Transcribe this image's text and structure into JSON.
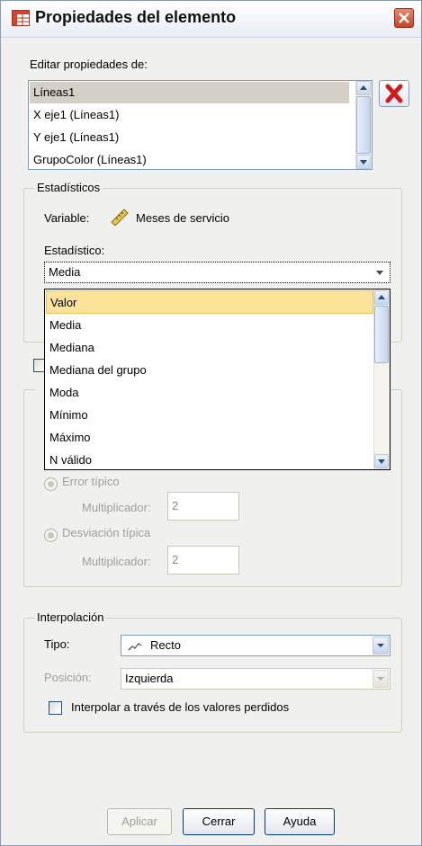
{
  "window": {
    "title": "Propiedades del elemento",
    "title_icon": "table-grid-icon",
    "close_icon": "close-x-icon"
  },
  "edit_props": {
    "label": "Editar propiedades de:",
    "items": [
      "Líneas1",
      "X eje1 (Líneas1)",
      "Y eje1 (Líneas1)",
      "GrupoColor (Líneas1)"
    ],
    "selected_index": 0,
    "delete_icon": "red-x-delete-icon"
  },
  "statistics": {
    "title": "Estadísticos",
    "variable_label": "Variable:",
    "variable_icon": "ruler-scale-icon",
    "variable_value": "Meses de servicio",
    "stat_label": "Estadístico:",
    "stat_value": "Media",
    "options": [
      "Valor",
      "Media",
      "Mediana",
      "Mediana del grupo",
      "Moda",
      "Mínimo",
      "Máximo",
      "N válido"
    ],
    "highlighted_option": "Valor"
  },
  "error_bars": {
    "std_error_label": "Error típico",
    "multiplier_label": "Multiplicador:",
    "std_error_multiplier": "2",
    "std_dev_label": "Desviación típica",
    "std_dev_multiplier": "2"
  },
  "interpolation": {
    "title": "Interpolación",
    "type_label": "Tipo:",
    "type_value": "Recto",
    "type_icon": "line-squiggle-icon",
    "position_label": "Posición:",
    "position_value": "Izquierda",
    "missing_label": "Interpolar a través de los valores perdidos"
  },
  "buttons": {
    "apply": "Aplicar",
    "close": "Cerrar",
    "help": "Ayuda"
  },
  "colors": {
    "highlight": "#fbe499",
    "selection": "#d4d0c8",
    "border_blue": "#7f9db9"
  }
}
